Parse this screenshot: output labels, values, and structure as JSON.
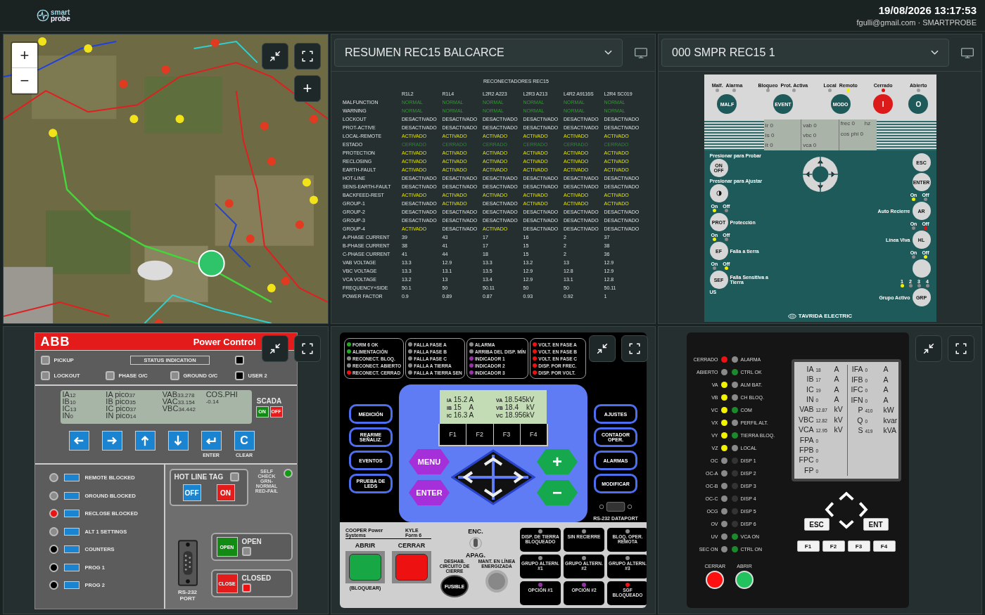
{
  "header": {
    "logo_top": "smart",
    "logo_bottom": "probe",
    "datetime": "19/08/2026 13:17:53",
    "user": "fgulli@gmail.com · SMARTPROBE"
  },
  "map": {
    "zoom_in": "+",
    "zoom_out": "−",
    "add": "+"
  },
  "summary": {
    "select": "RESUMEN REC15 BALCARCE",
    "title": "RECONECTADORES REC15",
    "columns": [
      "R1L2",
      "R1L4",
      "L2R2 A223",
      "L2R3 A213",
      "L4R2 A9116S",
      "L2R4 SC019"
    ],
    "rows": [
      {
        "label": "MALFUNCTION",
        "cells": [
          {
            "text": "NORMAL",
            "kind": "normal"
          },
          {
            "text": "NORMAL",
            "kind": "normal"
          },
          {
            "text": "NORMAL",
            "kind": "normal"
          },
          {
            "text": "NORMAL",
            "kind": "normal"
          },
          {
            "text": "NORMAL",
            "kind": "normal"
          },
          {
            "text": "NORMAL",
            "kind": "normal"
          }
        ]
      },
      {
        "label": "WARNING",
        "cells": [
          {
            "text": "NORMAL",
            "kind": "normal"
          },
          {
            "text": "NORMAL",
            "kind": "normal"
          },
          {
            "text": "NORMAL",
            "kind": "normal"
          },
          {
            "text": "NORMAL",
            "kind": "normal"
          },
          {
            "text": "NORMAL",
            "kind": "normal"
          },
          {
            "text": "NORMAL",
            "kind": "normal"
          }
        ]
      },
      {
        "label": "LOCKOUT",
        "cells": [
          "DESACTIVADO",
          "DESACTIVADO",
          "DESACTIVADO",
          "DESACTIVADO",
          "DESACTIVADO",
          "DESACTIVADO"
        ]
      },
      {
        "label": "PROT-ACTIVE",
        "cells": [
          "DESACTIVADO",
          "DESACTIVADO",
          "DESACTIVADO",
          "DESACTIVADO",
          "DESACTIVADO",
          "DESACTIVADO"
        ]
      },
      {
        "label": "LOCAL-REMOTE",
        "cells": [
          {
            "text": "ACTIVADO",
            "kind": "active"
          },
          {
            "text": "ACTIVADO",
            "kind": "active"
          },
          {
            "text": "ACTIVADO",
            "kind": "active"
          },
          {
            "text": "ACTIVADO",
            "kind": "active"
          },
          {
            "text": "ACTIVADO",
            "kind": "active"
          },
          {
            "text": "ACTIVADO",
            "kind": "active"
          }
        ]
      },
      {
        "label": "ESTADO",
        "cells": [
          {
            "text": "CERRADO",
            "kind": "closed"
          },
          {
            "text": "CERRADO",
            "kind": "closed"
          },
          {
            "text": "CERRADO",
            "kind": "closed"
          },
          {
            "text": "CERRADO",
            "kind": "closed"
          },
          {
            "text": "CERRADO",
            "kind": "closed"
          },
          {
            "text": "CERRADO",
            "kind": "closed"
          }
        ]
      },
      {
        "label": "PROTECTION",
        "cells": [
          {
            "text": "ACTIVADO",
            "kind": "active"
          },
          {
            "text": "ACTIVADO",
            "kind": "active"
          },
          {
            "text": "ACTIVADO",
            "kind": "active"
          },
          {
            "text": "ACTIVADO",
            "kind": "active"
          },
          {
            "text": "ACTIVADO",
            "kind": "active"
          },
          {
            "text": "ACTIVADO",
            "kind": "active"
          }
        ]
      },
      {
        "label": "RECLOSING",
        "cells": [
          {
            "text": "ACTIVADO",
            "kind": "active"
          },
          {
            "text": "ACTIVADO",
            "kind": "active"
          },
          {
            "text": "ACTIVADO",
            "kind": "active"
          },
          {
            "text": "ACTIVADO",
            "kind": "active"
          },
          {
            "text": "ACTIVADO",
            "kind": "active"
          },
          {
            "text": "ACTIVADO",
            "kind": "active"
          }
        ]
      },
      {
        "label": "EARTH-FAULT",
        "cells": [
          {
            "text": "ACTIVADO",
            "kind": "active"
          },
          {
            "text": "ACTIVADO",
            "kind": "active"
          },
          {
            "text": "ACTIVADO",
            "kind": "active"
          },
          {
            "text": "ACTIVADO",
            "kind": "active"
          },
          {
            "text": "ACTIVADO",
            "kind": "active"
          },
          {
            "text": "ACTIVADO",
            "kind": "active"
          }
        ]
      },
      {
        "label": "HOT-LINE",
        "cells": [
          "DESACTIVADO",
          "DESACTIVADO",
          "DESACTIVADO",
          "DESACTIVADO",
          "DESACTIVADO",
          "DESACTIVADO"
        ]
      },
      {
        "label": "SENS-EARTH-FAULT",
        "cells": [
          "DESACTIVADO",
          "DESACTIVADO",
          "DESACTIVADO",
          "DESACTIVADO",
          "DESACTIVADO",
          "DESACTIVADO"
        ]
      },
      {
        "label": "BACKFEED-REST",
        "cells": [
          {
            "text": "ACTIVADO",
            "kind": "active"
          },
          {
            "text": "ACTIVADO",
            "kind": "active"
          },
          {
            "text": "ACTIVADO",
            "kind": "active"
          },
          {
            "text": "ACTIVADO",
            "kind": "active"
          },
          {
            "text": "ACTIVADO",
            "kind": "active"
          },
          {
            "text": "ACTIVADO",
            "kind": "active"
          }
        ]
      },
      {
        "label": "GROUP-1",
        "cells": [
          "DESACTIVADO",
          {
            "text": "ACTIVADO",
            "kind": "active"
          },
          "DESACTIVADO",
          {
            "text": "ACTIVADO",
            "kind": "active"
          },
          {
            "text": "ACTIVADO",
            "kind": "active"
          },
          {
            "text": "ACTIVADO",
            "kind": "active"
          }
        ]
      },
      {
        "label": "GROUP-2",
        "cells": [
          "DESACTIVADO",
          "DESACTIVADO",
          "DESACTIVADO",
          "DESACTIVADO",
          "DESACTIVADO",
          "DESACTIVADO"
        ]
      },
      {
        "label": "GROUP-3",
        "cells": [
          "DESACTIVADO",
          "DESACTIVADO",
          "DESACTIVADO",
          "DESACTIVADO",
          "DESACTIVADO",
          "DESACTIVADO"
        ]
      },
      {
        "label": "GROUP-4",
        "cells": [
          {
            "text": "ACTIVADO",
            "kind": "active"
          },
          "DESACTIVADO",
          {
            "text": "ACTIVADO",
            "kind": "active"
          },
          "DESACTIVADO",
          "DESACTIVADO",
          "DESACTIVADO"
        ]
      },
      {
        "label": "A-PHASE CURRENT",
        "cells": [
          "39",
          "43",
          "17",
          "16",
          "2",
          "37"
        ]
      },
      {
        "label": "B-PHASE CURRENT",
        "cells": [
          "38",
          "41",
          "17",
          "15",
          "2",
          "38"
        ]
      },
      {
        "label": "C-PHASE CURRENT",
        "cells": [
          "41",
          "44",
          "18",
          "15",
          "2",
          "36"
        ]
      },
      {
        "label": "VAB VOLTAGE",
        "cells": [
          "13.3",
          "12.9",
          "13.3",
          "13.2",
          "13",
          "12.9"
        ]
      },
      {
        "label": "VBC VOLTAGE",
        "cells": [
          "13.3",
          "13.1",
          "13.5",
          "12.9",
          "12.8",
          "12.9"
        ]
      },
      {
        "label": "VCA VOLTAGE",
        "cells": [
          "13.2",
          "13",
          "13.4",
          "12.9",
          "13.1",
          "12.8"
        ]
      },
      {
        "label": "FREQUENCY+SIDE",
        "cells": [
          "50.1",
          "50",
          "50.11",
          "50",
          "50",
          "50.11"
        ]
      },
      {
        "label": "POWER FACTOR",
        "cells": [
          "0.9",
          "0.89",
          "0.87",
          "0.93",
          "0.92",
          "1"
        ]
      }
    ]
  },
  "device": {
    "select": "000 SMPR REC15 1",
    "top": [
      {
        "leds": [
          {
            "text": "Malf.",
            "color": "#9a9a9a"
          },
          {
            "text": "Alarma",
            "color": "#9a9a9a"
          }
        ],
        "button": "MALF",
        "kind": "dark"
      },
      {
        "leds": [
          {
            "text": "Bloqueo",
            "color": "#9a9a9a"
          },
          {
            "text": "Prot. Activa",
            "color": "#9a9a9a"
          }
        ],
        "button": "EVENT",
        "kind": "dark"
      },
      {
        "leds": [
          {
            "text": "Local",
            "color": "#9a9a9a"
          },
          {
            "text": "Remoto",
            "color": "#f2f200"
          }
        ],
        "button": "MODO",
        "kind": "dark"
      },
      {
        "leds": [
          {
            "text": "Cerrado",
            "color": "#e01010"
          }
        ],
        "button": "I",
        "kind": "red"
      },
      {
        "leds": [
          {
            "text": "Abierto",
            "color": "#9a9a9a"
          }
        ],
        "button": "O",
        "kind": "ring"
      }
    ],
    "lcd": [
      [
        {
          "label": "Ir",
          "value": "0"
        },
        {
          "label": "Is",
          "value": "0"
        },
        {
          "label": "It",
          "value": "0"
        }
      ],
      [
        {
          "label": "vab",
          "value": "0"
        },
        {
          "label": "vbc",
          "value": "0"
        },
        {
          "label": "vca",
          "value": "0"
        }
      ],
      [
        {
          "label": "frec",
          "value": "0",
          "unit": "hz"
        },
        {
          "label": "cos phi",
          "value": "0"
        }
      ]
    ],
    "left": [
      {
        "kind": "button",
        "caption": "Presionar para Probar",
        "button": "ON OFF"
      },
      {
        "kind": "contrast",
        "caption": "Presionar para Ajustar"
      },
      {
        "kind": "button",
        "leds": [
          {
            "text": "On",
            "color": "#f2f200"
          },
          {
            "text": "Off",
            "color": "#8a8a8a"
          }
        ],
        "button": "PROT",
        "label": "Protección"
      },
      {
        "kind": "button",
        "leds": [
          {
            "text": "On",
            "color": "#f2f200"
          },
          {
            "text": "Off",
            "color": "#8a8a8a"
          }
        ],
        "button": "EF",
        "label": "Falla a tierra"
      },
      {
        "kind": "button",
        "leds": [
          {
            "text": "On",
            "color": "#8a8a8a"
          },
          {
            "text": "Off",
            "color": "#f2f200"
          }
        ],
        "button": "SEF",
        "label": "Falla Sensitiva a Tierra",
        "note": "US"
      }
    ],
    "right": [
      {
        "button": "ESC"
      },
      {
        "button": "ENTER"
      },
      {
        "leds": [
          {
            "text": "On",
            "color": "#f2f200"
          },
          {
            "text": "Off",
            "color": "#8a8a8a"
          }
        ],
        "button": "AR",
        "label": "Auto Recierre"
      },
      {
        "leds": [
          {
            "text": "On",
            "color": "#8a8a8a"
          },
          {
            "text": "Off",
            "color": "#e01010"
          }
        ],
        "button": "HL",
        "label": "Línea Viva"
      },
      {
        "leds": [
          {
            "text": "On",
            "color": "#8a8a8a"
          },
          {
            "text": "Off",
            "color": "#f2f200"
          }
        ]
      },
      {
        "leds": [
          {
            "text": "1",
            "color": "#f2f200"
          },
          {
            "text": "2",
            "color": "#8a8a8a"
          },
          {
            "text": "3",
            "color": "#8a8a8a"
          },
          {
            "text": "4",
            "color": "#8a8a8a"
          }
        ],
        "button": "GRP",
        "label": "Grupo Activo"
      }
    ],
    "brand": "TAVRIDA ELECTRIC"
  },
  "abb": {
    "logo": "ABB",
    "title": "Power Control",
    "status_title": "STATUS INDICATION",
    "status_leds": [
      {
        "label": "PICKUP",
        "color": "#8c8c8c"
      },
      {
        "color": "#000000"
      },
      {
        "label": "LOCKOUT",
        "color": "#8c8c8c"
      },
      {
        "label": "PHASE O/C",
        "color": "#8c8c8c"
      },
      {
        "label": "GROUND O/C",
        "color": "#8c8c8c"
      },
      {
        "label": "USER 2",
        "color": "#000000"
      }
    ],
    "lcd": [
      [
        {
          "label": "IA",
          "value": "12"
        },
        {
          "label": "IB",
          "value": "10"
        },
        {
          "label": "IC",
          "value": "13"
        },
        {
          "label": "IN",
          "value": "0"
        }
      ],
      [
        {
          "label": "IA pico",
          "value": "37"
        },
        {
          "label": "IB pico",
          "value": "35"
        },
        {
          "label": "IC pico",
          "value": "37"
        },
        {
          "label": "IN pico",
          "value": "14"
        }
      ],
      [
        {
          "label": "VAB",
          "value": "33.278"
        },
        {
          "label": "VAC",
          "value": "33.154"
        },
        {
          "label": "VBC",
          "value": "34.442"
        }
      ],
      [
        {
          "label": "COS.PHI"
        },
        {
          "value": "-0.14"
        }
      ]
    ],
    "scada": {
      "label": "SCADA",
      "on": "ON",
      "off": "OFF"
    },
    "keys": [
      {
        "kind": "left"
      },
      {
        "kind": "right"
      },
      {
        "kind": "up"
      },
      {
        "kind": "down"
      },
      {
        "kind": "enter",
        "caption": "ENTER"
      },
      {
        "kind": "clear",
        "text": "C",
        "caption": "CLEAR"
      }
    ],
    "targets": [
      {
        "label": "REMOTE BLOCKED",
        "color": "#8c8c8c"
      },
      {
        "label": "GROUND BLOCKED",
        "color": "#8c8c8c"
      },
      {
        "label": "RECLOSE BLOCKED",
        "color": "#ee1111"
      },
      {
        "label": "ALT 1 SETTINGS",
        "color": "#8c8c8c"
      },
      {
        "label": "COUNTERS",
        "color": "#000000"
      },
      {
        "label": "PROG 1",
        "color": "#000000"
      },
      {
        "label": "PROG 2",
        "color": "#000000"
      }
    ],
    "hot_line": {
      "title": "HOT LINE TAG",
      "off": "OFF",
      "on": "ON",
      "color": "#8c8c8c"
    },
    "self_check": {
      "lines": [
        "SELF CHECK",
        "GRN-NORMAL",
        "RED-FAIL"
      ],
      "color": "#139a13"
    },
    "port": [
      "RS-232",
      "PORT"
    ],
    "breaker": [
      {
        "kind": "open",
        "button": "OPEN",
        "label": "OPEN",
        "color": "#8c8c8c"
      },
      {
        "kind": "close",
        "button": "CLOSE",
        "label": "CLOSED",
        "color": "#ee1111"
      }
    ]
  },
  "cooper": {
    "led_groups": [
      [
        {
          "label": "FORM 6 OK",
          "color": "#22aa22"
        },
        {
          "label": "ALIMENTACIÓN",
          "color": "#22aa22"
        },
        {
          "label": "RECONECT. BLOQ.",
          "color": "#8a8a8a"
        },
        {
          "label": "RECONECT. ABIERTO",
          "color": "#8a8a8a"
        },
        {
          "label": "RECONECT. CERRAD",
          "color": "#ee1111"
        }
      ],
      [
        {
          "label": "FALLA FASE A",
          "color": "#8a8a8a"
        },
        {
          "label": "FALLA FASE B",
          "color": "#8a8a8a"
        },
        {
          "label": "FALLA FASE C",
          "color": "#8a8a8a"
        },
        {
          "label": "FALLA A TIERRA",
          "color": "#8a8a8a"
        },
        {
          "label": "FALLA A TIERRA SEN",
          "color": "#8a8a8a"
        }
      ],
      [
        {
          "label": "ALARMA",
          "color": "#8a8a8a"
        },
        {
          "label": "ARRIBA DEL DISP. MÍN",
          "color": "#8a8a8a"
        },
        {
          "label": "INDICADOR 1",
          "color": "#9b2fae"
        },
        {
          "label": "INDICADOR 2",
          "color": "#9b2fae"
        },
        {
          "label": "INDICADOR 3",
          "color": "#9b2fae"
        }
      ],
      [
        {
          "label": "VOLT. EN FASE A",
          "color": "#ee1111"
        },
        {
          "label": "VOLT. EN FASE B",
          "color": "#ee1111"
        },
        {
          "label": "VOLT. EN FASE C",
          "color": "#ee1111"
        },
        {
          "label": "DISP. POR FREC.",
          "color": "#ee1111"
        },
        {
          "label": "DISP. POR VOLT.",
          "color": "#ee1111"
        }
      ]
    ],
    "lcd": [
      [
        {
          "label": "IA",
          "value": "15.2 A"
        },
        {
          "label": "VA",
          "value": "18.545kV"
        }
      ],
      [
        {
          "label": "IB",
          "value": "15    A"
        },
        {
          "label": "VB",
          "value": "18.4    kV"
        }
      ],
      [
        {
          "label": "IC",
          "value": "16.3 A"
        },
        {
          "label": "VC",
          "value": "18.956kV"
        }
      ]
    ],
    "softkeys": [
      "F1",
      "F2",
      "F3",
      "F4"
    ],
    "left_buttons": [
      "MEDICIÓN",
      "REARME SEÑALIZ.",
      "EVENTOS",
      "PRUEBA DE LEDS"
    ],
    "right_buttons": [
      "AJUSTES",
      "CONTADOR OPER.",
      "ALARMAS",
      "MODIFICAR"
    ],
    "menu": "MENU",
    "enter": "ENTER",
    "plus": "+",
    "minus": "−",
    "dataport": "RS-232 DATAPORT",
    "brand": "COOPER Power Systems",
    "model": "KYLE Form 6",
    "open": {
      "label": "ABRIR",
      "note": "(BLOQUEAR)"
    },
    "close": {
      "label": "CERRAR"
    },
    "switch": {
      "on": "ENC.",
      "off": "APAG."
    },
    "fuse": {
      "caption": "DESHAB. CIRCUITO DE CIERRE",
      "button": "FUSIBLE"
    },
    "hot_line": {
      "caption": "MANT. EN LÍNEA ENERGIZADA"
    },
    "options": [
      {
        "label": "DISP. DE TIERRA BLOQUEADO",
        "color": "#8a8a8a"
      },
      {
        "label": "SIN RECIERRE",
        "color": "#8a8a8a"
      },
      {
        "label": "BLOQ. OPER. REMOTA",
        "color": "#8a8a8a"
      },
      {
        "label": "GRUPO ALTERN. #1",
        "color": "#8a8a8a"
      },
      {
        "label": "GRUPO ALTERN. #2",
        "color": "#8a8a8a"
      },
      {
        "label": "GRUPO ALTERN. #3",
        "color": "#8a8a8a"
      },
      {
        "label": "OPCIÓN #1",
        "color": "#9b2fae"
      },
      {
        "label": "OPCIÓN #2",
        "color": "#9b2fae"
      },
      {
        "label": "SGF BLOQUEADO",
        "color": "#ee1111"
      }
    ]
  },
  "relay": {
    "leds_left": [
      {
        "label": "CERRADO",
        "color": "#ee1111"
      },
      {
        "label": "ABIERTO",
        "color": "#8a8a8a"
      },
      {
        "label": "VA",
        "color": "#f2f200"
      },
      {
        "label": "VB",
        "color": "#f2f200"
      },
      {
        "label": "VC",
        "color": "#f2f200"
      },
      {
        "label": "VX",
        "color": "#f2f200"
      },
      {
        "label": "VY",
        "color": "#f2f200"
      },
      {
        "label": "VZ",
        "color": "#f2f200"
      },
      {
        "label": "OC",
        "color": "#8a8a8a"
      },
      {
        "label": "OC-A",
        "color": "#8a8a8a"
      },
      {
        "label": "OC-B",
        "color": "#8a8a8a"
      },
      {
        "label": "OC-C",
        "color": "#8a8a8a"
      },
      {
        "label": "OCG",
        "color": "#8a8a8a"
      },
      {
        "label": "OV",
        "color": "#8a8a8a"
      },
      {
        "label": "UV",
        "color": "#8a8a8a"
      },
      {
        "label": "SEC ON",
        "color": "#8a8a8a"
      }
    ],
    "leds_right": [
      {
        "label": "ALARMA",
        "color": "#8a8a8a"
      },
      {
        "label": "CTRL OK",
        "color": "#1a8a2a"
      },
      {
        "label": "ALM BAT.",
        "color": "#8a8a8a"
      },
      {
        "label": "CH BLOQ.",
        "color": "#8a8a8a"
      },
      {
        "label": "COM",
        "color": "#1a8a2a"
      },
      {
        "label": "PERFIL ALT.",
        "color": "#8a8a8a"
      },
      {
        "label": "TIERRA BLOQ.",
        "color": "#1a8a2a"
      },
      {
        "label": "LOCAL",
        "color": "#8a8a8a"
      },
      {
        "label": "DISP 1",
        "color": "#333333"
      },
      {
        "label": "DISP 2",
        "color": "#333333"
      },
      {
        "label": "DISP 3",
        "color": "#333333"
      },
      {
        "label": "DISP 4",
        "color": "#333333"
      },
      {
        "label": "DISP 5",
        "color": "#333333"
      },
      {
        "label": "DISP 6",
        "color": "#333333"
      },
      {
        "label": "VCA ON",
        "color": "#1a8a2a"
      },
      {
        "label": "CTRL ON",
        "color": "#1a8a2a"
      }
    ],
    "lcd_left": [
      {
        "label": "IA",
        "value": "18",
        "unit": "A"
      },
      {
        "label": "IB",
        "value": "17",
        "unit": "A"
      },
      {
        "label": "IC",
        "value": "19",
        "unit": "A"
      },
      {
        "label": "IN",
        "value": "0",
        "unit": "A"
      },
      {
        "label": "VAB",
        "value": "12.87",
        "unit": "kV"
      },
      {
        "label": "VBC",
        "value": "12.82",
        "unit": "kV"
      },
      {
        "label": "VCA",
        "value": "12.95",
        "unit": "kV"
      },
      {
        "label": "FPA",
        "value": "0"
      },
      {
        "label": "FPB",
        "value": "0"
      },
      {
        "label": "FPC",
        "value": "0"
      },
      {
        "label": "FP",
        "value": "0"
      }
    ],
    "lcd_right": [
      {
        "label": "IFA",
        "value": "0",
        "unit": "A"
      },
      {
        "label": "IFB",
        "value": "0",
        "unit": "A"
      },
      {
        "label": "IFC",
        "value": "0",
        "unit": "A"
      },
      {
        "label": "IFN",
        "value": "0",
        "unit": "A"
      },
      {
        "label": "P",
        "value": "410",
        "unit": "kW"
      },
      {
        "label": "Q",
        "value": "0",
        "unit": "kvar"
      },
      {
        "label": "S",
        "value": "419",
        "unit": "kVA"
      }
    ],
    "esc": "ESC",
    "ent": "ENT",
    "fkeys": [
      "F1",
      "F2",
      "F3",
      "F4"
    ],
    "breaker": [
      {
        "label": "CERRAR",
        "color": "#ff1010"
      },
      {
        "label": "ABRIR",
        "color": "#22c35e"
      }
    ]
  }
}
